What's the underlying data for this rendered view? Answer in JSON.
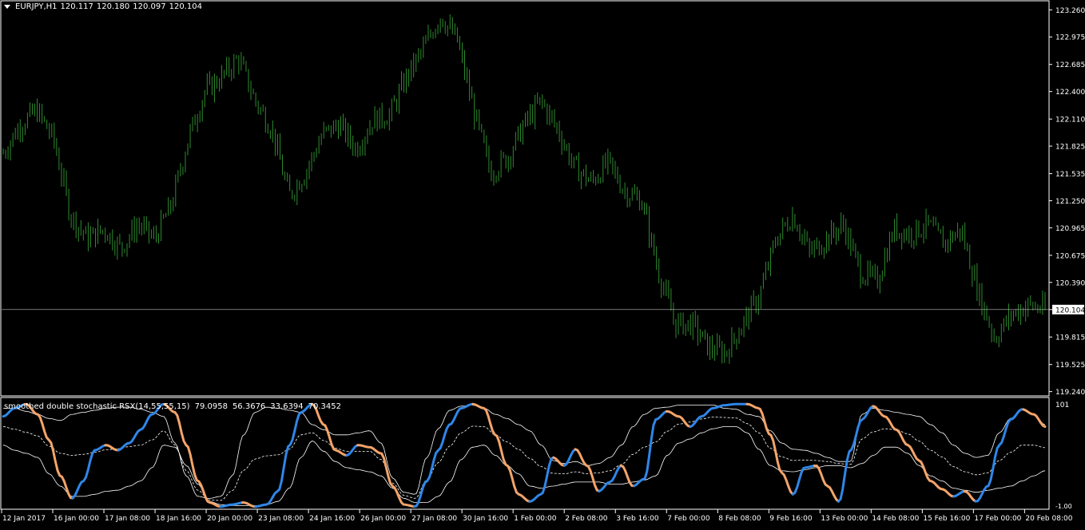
{
  "window": {
    "symbol": "EURJPY,H1",
    "open": "120.117",
    "high": "120.180",
    "low": "120.097",
    "close": "120.104"
  },
  "indicator": {
    "name": "smoothed double stochastic RSX(14,55,55,15)",
    "values": [
      "79.0958",
      "56.3676",
      "33.6394",
      "70.3452"
    ],
    "scale_max": "101",
    "scale_min": "-1.00"
  },
  "colors": {
    "background": "#000000",
    "candles": "#2e8b2e",
    "grid_frame": "#ffffff",
    "line_up": "#2f86e8",
    "line_down": "#f4a46a",
    "bands": "#ffffff"
  },
  "chart_data": [
    {
      "type": "candlestick",
      "title": "EURJPY,H1",
      "price_axis_labels": [
        "123.260",
        "122.975",
        "122.685",
        "122.400",
        "122.110",
        "121.825",
        "121.535",
        "121.250",
        "120.965",
        "120.675",
        "120.390",
        "120.104",
        "119.815",
        "119.525",
        "119.240"
      ],
      "ylim": [
        119.22,
        123.33
      ],
      "current_price": 120.104,
      "x_tick_labels": [
        "12 Jan 2017",
        "16 Jan 00:00",
        "17 Jan 08:00",
        "18 Jan 16:00",
        "20 Jan 00:00",
        "23 Jan 08:00",
        "24 Jan 16:00",
        "26 Jan 00:00",
        "27 Jan 08:00",
        "30 Jan 16:00",
        "1 Feb 00:00",
        "2 Feb 08:00",
        "3 Feb 16:00",
        "7 Feb 00:00",
        "8 Feb 08:00",
        "9 Feb 16:00",
        "13 Feb 00:00",
        "14 Feb 08:00",
        "15 Feb 16:00",
        "17 Feb 00:00",
        "20 Feb 08:00"
      ],
      "close_path": [
        [
          "12 Jan 2017",
          121.75
        ],
        [
          "13 Jan",
          122.05
        ],
        [
          "13 Jan",
          122.2
        ],
        [
          "14 Jan",
          121.9
        ],
        [
          "16 Jan 00:00",
          121.1
        ],
        [
          "16 Jan",
          120.85
        ],
        [
          "17 Jan",
          120.95
        ],
        [
          "17 Jan 08:00",
          120.75
        ],
        [
          "17 Jan",
          121.0
        ],
        [
          "18 Jan",
          120.85
        ],
        [
          "18 Jan",
          121.2
        ],
        [
          "18 Jan 16:00",
          121.9
        ],
        [
          "19 Jan",
          122.4
        ],
        [
          "19 Jan",
          122.55
        ],
        [
          "20 Jan 00:00",
          122.75
        ],
        [
          "20 Jan",
          122.3
        ],
        [
          "21 Jan",
          122.0
        ],
        [
          "23 Jan 08:00",
          121.3
        ],
        [
          "23 Jan",
          121.55
        ],
        [
          "24 Jan",
          121.95
        ],
        [
          "24 Jan 16:00",
          122.05
        ],
        [
          "25 Jan",
          121.8
        ],
        [
          "25 Jan",
          122.1
        ],
        [
          "26 Jan 00:00",
          122.15
        ],
        [
          "26 Jan",
          122.55
        ],
        [
          "27 Jan",
          122.85
        ],
        [
          "27 Jan 08:00",
          123.2
        ],
        [
          "27 Jan",
          122.95
        ],
        [
          "30 Jan",
          122.2
        ],
        [
          "30 Jan 16:00",
          121.55
        ],
        [
          "31 Jan",
          121.7
        ],
        [
          "31 Jan",
          122.05
        ],
        [
          "1 Feb 00:00",
          122.3
        ],
        [
          "1 Feb",
          122.0
        ],
        [
          "2 Feb",
          121.6
        ],
        [
          "2 Feb 08:00",
          121.45
        ],
        [
          "2 Feb",
          121.65
        ],
        [
          "3 Feb",
          121.35
        ],
        [
          "3 Feb 16:00",
          121.25
        ],
        [
          "6 Feb",
          120.5
        ],
        [
          "7 Feb 00:00",
          119.95
        ],
        [
          "7 Feb",
          119.95
        ],
        [
          "8 Feb",
          119.7
        ],
        [
          "8 Feb 08:00",
          119.65
        ],
        [
          "8 Feb",
          119.95
        ],
        [
          "9 Feb",
          120.25
        ],
        [
          "9 Feb 16:00",
          120.85
        ],
        [
          "10 Feb",
          121.1
        ],
        [
          "10 Feb",
          120.7
        ],
        [
          "13 Feb 00:00",
          120.85
        ],
        [
          "13 Feb",
          121.0
        ],
        [
          "14 Feb",
          120.5
        ],
        [
          "14 Feb 08:00",
          120.4
        ],
        [
          "14 Feb",
          120.95
        ],
        [
          "15 Feb 16:00",
          120.9
        ],
        [
          "16 Feb",
          121.0
        ],
        [
          "16 Feb",
          120.8
        ],
        [
          "17 Feb 00:00",
          120.95
        ],
        [
          "17 Feb",
          120.3
        ],
        [
          "20 Feb 08:00",
          119.8
        ],
        [
          "20 Feb",
          120.05
        ],
        [
          "20 Feb",
          120.15
        ],
        [
          "20 Feb",
          120.104
        ]
      ]
    },
    {
      "type": "line",
      "title": "smoothed double stochastic RSX(14,55,55,15)",
      "ylim": [
        -1,
        101
      ],
      "x_tick_labels": [
        "12 Jan 2017",
        "16 Jan 00:00",
        "17 Jan 08:00",
        "18 Jan 16:00",
        "20 Jan 00:00",
        "23 Jan 08:00",
        "24 Jan 16:00",
        "26 Jan 00:00",
        "27 Jan 08:00",
        "30 Jan 16:00",
        "1 Feb 00:00",
        "2 Feb 08:00",
        "3 Feb 16:00",
        "7 Feb 00:00",
        "8 Feb 08:00",
        "9 Feb 16:00",
        "13 Feb 00:00",
        "14 Feb 08:00",
        "15 Feb 16:00",
        "17 Feb 00:00",
        "20 Feb 08:00"
      ],
      "series": [
        {
          "values": [
            88,
            96,
            100,
            90,
            65,
            30,
            8,
            25,
            55,
            60,
            55,
            62,
            75,
            90,
            100,
            92,
            60,
            25,
            4,
            0,
            2,
            4,
            0,
            2,
            15,
            60,
            92,
            100,
            80,
            55,
            50,
            60,
            58,
            52,
            20,
            2,
            0,
            25,
            55,
            80,
            96,
            100,
            96,
            70,
            40,
            12,
            5,
            12,
            48,
            40,
            56,
            40,
            15,
            24,
            40,
            20,
            27,
            85,
            93,
            88,
            78,
            88,
            96,
            99,
            100,
            100,
            96,
            70,
            33,
            12,
            38,
            40,
            20,
            5,
            55,
            85,
            98,
            88,
            75,
            60,
            45,
            25,
            17,
            10,
            15,
            5,
            20,
            60,
            85,
            95,
            90,
            78
          ]
        }
      ],
      "bands": {
        "upper": [
          96,
          96,
          93,
          90,
          86,
          84,
          90,
          92,
          94,
          96,
          97,
          97,
          95,
          92,
          88,
          62,
          30,
          10,
          8,
          10,
          30,
          70,
          92,
          97,
          96,
          94,
          92,
          80,
          75,
          70,
          70,
          72,
          74,
          62,
          28,
          14,
          12,
          48,
          76,
          94,
          98,
          99,
          96,
          90,
          86,
          80,
          74,
          60,
          45,
          42,
          44,
          40,
          42,
          48,
          60,
          78,
          90,
          96,
          97,
          99,
          99,
          99,
          99,
          96,
          95,
          90,
          88,
          74,
          62,
          56,
          55,
          52,
          48,
          44,
          44,
          90,
          96,
          94,
          92,
          90,
          88,
          80,
          72,
          60,
          52,
          48,
          50,
          72,
          86,
          95,
          90,
          80
        ],
        "lower": [
          60,
          55,
          52,
          48,
          32,
          20,
          10,
          10,
          12,
          15,
          16,
          20,
          25,
          38,
          60,
          58,
          40,
          22,
          5,
          2,
          1,
          1,
          1,
          2,
          5,
          18,
          48,
          64,
          54,
          44,
          38,
          36,
          34,
          30,
          18,
          8,
          4,
          4,
          10,
          24,
          46,
          58,
          60,
          50,
          40,
          32,
          20,
          18,
          20,
          22,
          24,
          24,
          24,
          22,
          22,
          24,
          26,
          30,
          50,
          62,
          66,
          72,
          76,
          78,
          78,
          72,
          56,
          40,
          35,
          34,
          36,
          38,
          40,
          40,
          38,
          42,
          50,
          58,
          58,
          52,
          40,
          30,
          25,
          18,
          16,
          14,
          16,
          18,
          20,
          25,
          30,
          35
        ]
      }
    }
  ]
}
